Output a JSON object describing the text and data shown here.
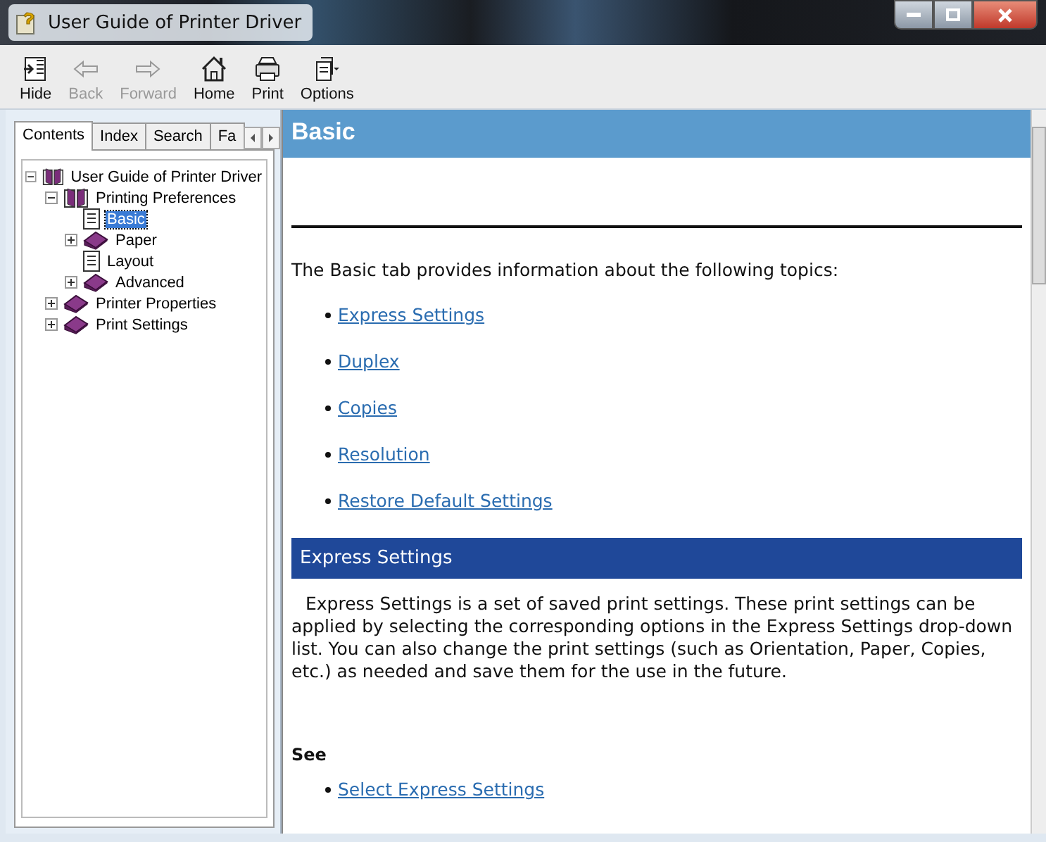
{
  "window": {
    "title": "User Guide of Printer Driver"
  },
  "toolbar": [
    {
      "label": "Hide",
      "kind": "hide",
      "disabled": false
    },
    {
      "label": "Back",
      "kind": "back",
      "disabled": true
    },
    {
      "label": "Forward",
      "kind": "forward",
      "disabled": true
    },
    {
      "label": "Home",
      "kind": "home",
      "disabled": false
    },
    {
      "label": "Print",
      "kind": "print",
      "disabled": false
    },
    {
      "label": "Options",
      "kind": "options",
      "disabled": false
    }
  ],
  "nav_tabs": [
    {
      "label": "Contents",
      "selected": true
    },
    {
      "label": "Index",
      "selected": false
    },
    {
      "label": "Search",
      "selected": false
    },
    {
      "label": "Fa",
      "selected": false
    }
  ],
  "tree": [
    {
      "label": "User Guide of Printer Driver",
      "kind": "book",
      "expanded": true,
      "selected": false,
      "children": [
        {
          "label": "Printing Preferences",
          "kind": "book",
          "expanded": true,
          "selected": false,
          "children": [
            {
              "label": "Basic",
              "kind": "page",
              "selected": true
            },
            {
              "label": "Paper",
              "kind": "book",
              "expanded": false,
              "selected": false
            },
            {
              "label": "Layout",
              "kind": "page",
              "selected": false
            },
            {
              "label": "Advanced",
              "kind": "book",
              "expanded": false,
              "selected": false
            }
          ]
        },
        {
          "label": "Printer Properties",
          "kind": "book",
          "expanded": false,
          "selected": false
        },
        {
          "label": "Print Settings",
          "kind": "book",
          "expanded": false,
          "selected": false
        }
      ]
    }
  ],
  "topic": {
    "title": "Basic",
    "intro": "The Basic tab provides information about the following topics:",
    "links": [
      "Express Settings",
      "Duplex",
      "Copies",
      "Resolution",
      "Restore Default Settings"
    ],
    "section_title": "Express Settings",
    "section_text": "Express Settings is a set of saved print settings. These print settings can be applied by selecting the corresponding options in the Express Settings drop-down list. You can also change the print settings (such as Orientation, Paper, Copies, etc.) as needed and save them for the use in the future.",
    "see_heading": "See",
    "see_links": [
      "Select Express Settings"
    ]
  }
}
